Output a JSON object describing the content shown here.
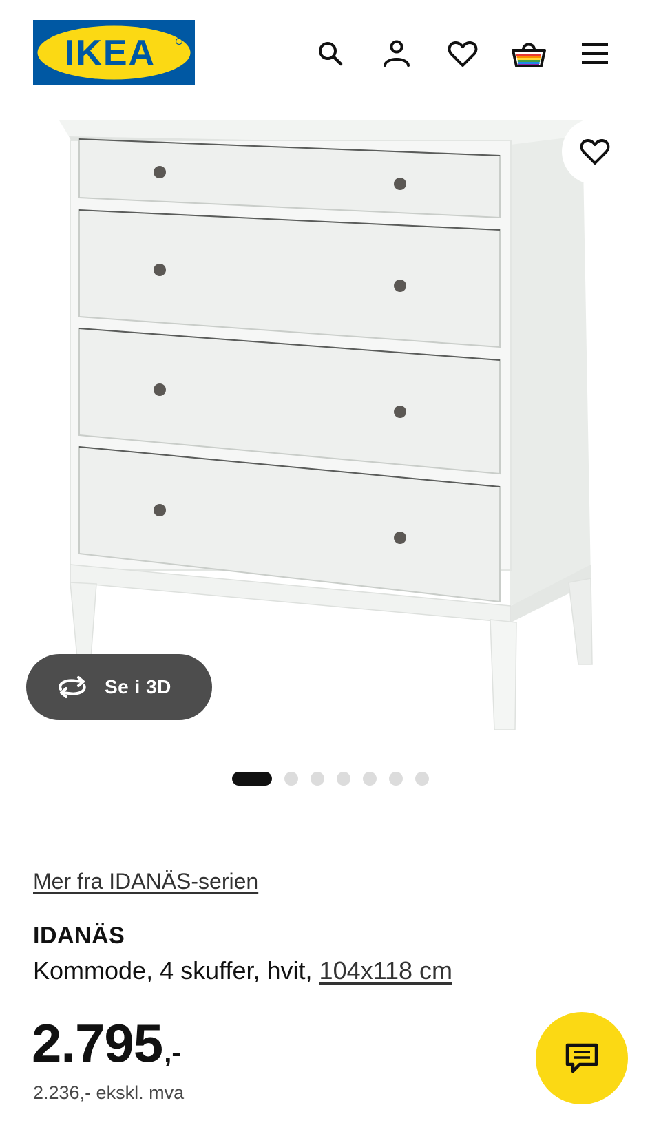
{
  "header": {
    "logo_text": "IKEA",
    "icons": [
      "search-icon",
      "account-icon",
      "heart-icon",
      "basket-icon",
      "menu-icon"
    ]
  },
  "hero": {
    "image_subject": "white 4-drawer chest",
    "view_3d_label": "Se i 3D",
    "carousel": {
      "total": 7,
      "active": 1
    }
  },
  "product": {
    "series_link": "Mer fra IDANÄS-serien",
    "name": "IDANÄS",
    "description": "Kommode, 4 skuffer, hvit,",
    "size": "104x118 cm",
    "price_main": "2.795",
    "price_suffix": ",-",
    "price_excl_vat": "2.236,- ekskl. mva"
  },
  "colors": {
    "brand_blue": "#0058a3",
    "brand_yellow": "#fbd914",
    "button_dark": "#4d4d4d"
  }
}
